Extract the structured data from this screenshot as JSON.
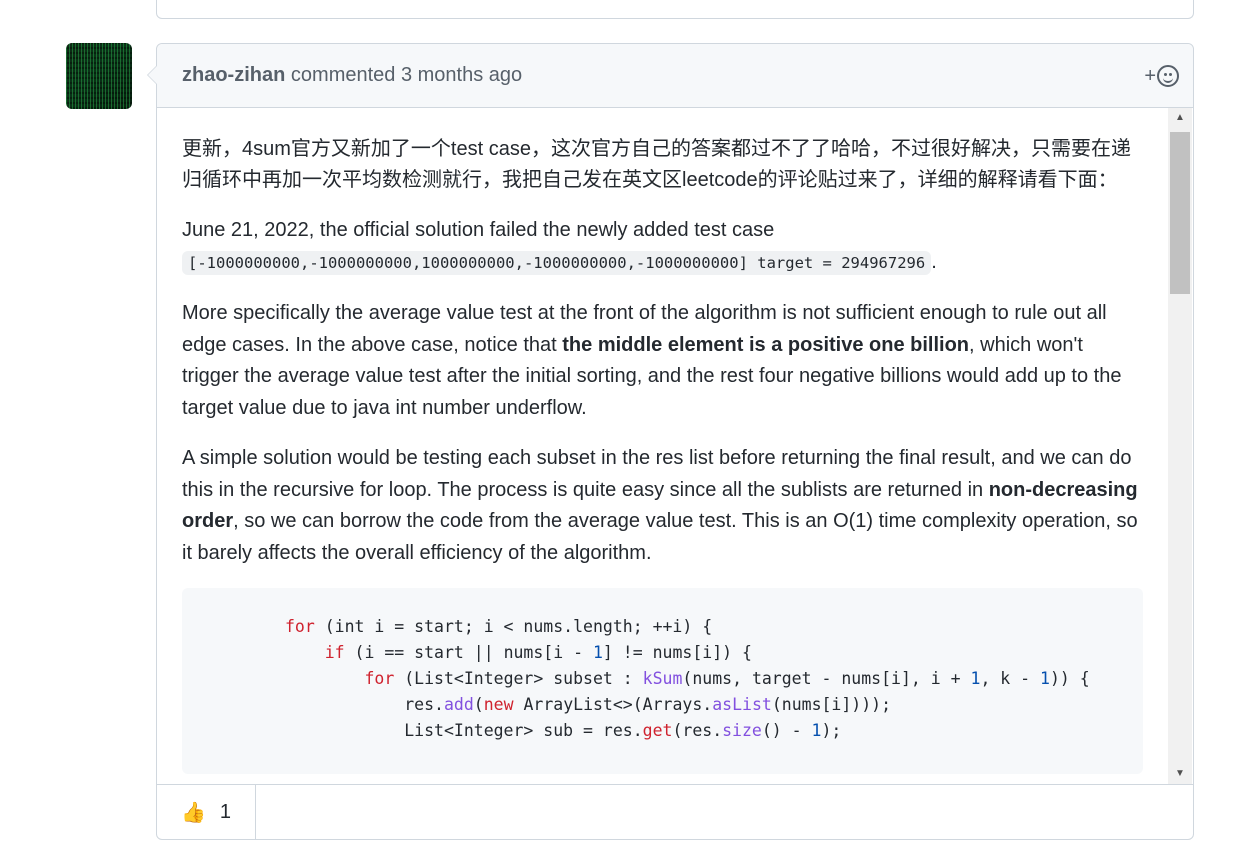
{
  "comment": {
    "author": "zhao-zihan",
    "action": "commented",
    "time": "3 months ago",
    "add_reaction_plus": "+",
    "paragraphs": {
      "zh": "更新，4sum官方又新加了一个test case，这次官方自己的答案都过不了了哈哈，不过很好解决，只需要在递归循环中再加一次平均数检测就行，我把自己发在英文区leetcode的评论贴过来了，详细的解释请看下面：",
      "p2_text": "June 21, 2022, the official solution failed the newly added test case ",
      "p2_code": "[-1000000000,-1000000000,1000000000,-1000000000,-1000000000] target = 294967296",
      "p2_end": ".",
      "p3_a": "More specifically the average value test at the front of the algorithm is not sufficient enough to rule out all edge cases. In the above case, notice that ",
      "p3_bold": "the middle element is a positive one billion",
      "p3_b": ", which won't trigger the average value test after the initial sorting, and the rest four negative billions would add up to the target value due to java int number underflow.",
      "p4_a": "A simple solution would be testing each subset in the res list before returning the final result, and we can do this in the recursive for loop. The process is quite easy since all the sublists are returned in ",
      "p4_bold": "non-decreasing order",
      "p4_b": ", so we can borrow the code from the average value test. This is an O(1) time complexity operation, so it barely affects the overall efficiency of the algorithm."
    },
    "code": {
      "l1": {
        "kw": "for",
        "rest": " (int i = start; i < nums.length; ++i) {"
      },
      "l2": {
        "kw": "if",
        "a": " (i == start || nums[i - ",
        "n": "1",
        "b": "] != nums[i]) {"
      },
      "l3": {
        "kw": "for",
        "a": " (List<Integer> subset : ",
        "fn": "kSum",
        "b": "(nums, target - nums[i], i + ",
        "n1": "1",
        "c": ", k - ",
        "n2": "1",
        "d": ")) {"
      },
      "l4": {
        "a": "res.",
        "fn1": "add",
        "b": "(",
        "kw": "new",
        "c": " ArrayList<>(Arrays.",
        "fn2": "asList",
        "d": "(nums[i])));"
      },
      "l5": {
        "a": "List<Integer> sub = res.",
        "fn1": "get",
        "b": "(res.",
        "fn2": "size",
        "c": "() - ",
        "n": "1",
        "d": ");"
      }
    },
    "reaction": {
      "emoji": "👍",
      "count": "1"
    }
  },
  "icons": {
    "smiley": "smiley-icon",
    "scroll_up": "▲",
    "scroll_down": "▼",
    "prev_scroll_down": "▼"
  }
}
